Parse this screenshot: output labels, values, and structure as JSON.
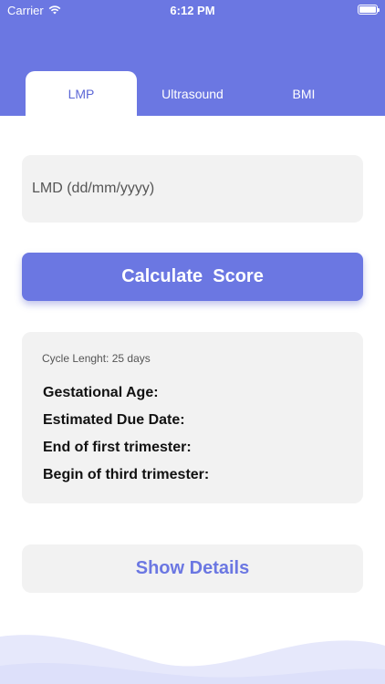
{
  "status_bar": {
    "carrier": "Carrier",
    "time": "6:12 PM"
  },
  "tabs": [
    {
      "label": "LMP",
      "active": true
    },
    {
      "label": "Ultrasound",
      "active": false
    },
    {
      "label": "BMI",
      "active": false
    }
  ],
  "lmd_input": {
    "placeholder": "LMD (dd/mm/yyyy)",
    "value": ""
  },
  "calculate_button": {
    "label": "Calculate  Score"
  },
  "results": {
    "cycle_length": "Cycle Lenght: 25 days",
    "gestational_age": "Gestational Age:",
    "due_date": "Estimated Due Date:",
    "end_first_trimester": "End of first trimester:",
    "begin_third_trimester": "Begin of third trimester:"
  },
  "details_button": {
    "label": "Show Details"
  },
  "colors": {
    "accent": "#6b77e2",
    "card": "#f2f2f2",
    "wave": "#e6e8fb"
  }
}
